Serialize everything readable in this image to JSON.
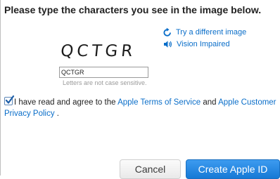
{
  "heading": "Please type the characters you see in the image below.",
  "captcha": {
    "text": "QCTGR"
  },
  "links": {
    "refresh": "Try a different image",
    "audio": "Vision Impaired"
  },
  "answer": {
    "value": "QCTGR"
  },
  "hint": "Letters are not case sensitive.",
  "agreement": {
    "checked": true,
    "prefix": "I have read and agree to the",
    "terms_link": "Apple Terms of Service",
    "conjunction": "and",
    "privacy_link": "Apple Customer Privacy Policy",
    "suffix": "."
  },
  "buttons": {
    "cancel": "Cancel",
    "create": "Create Apple ID"
  },
  "colors": {
    "link": "#0a6ec9",
    "primary_button": "#2a8ae4",
    "hint_text": "#9b9b9b"
  },
  "icons": {
    "refresh": "refresh-icon",
    "audio": "speaker-icon",
    "checkbox": "checkmark-icon"
  }
}
